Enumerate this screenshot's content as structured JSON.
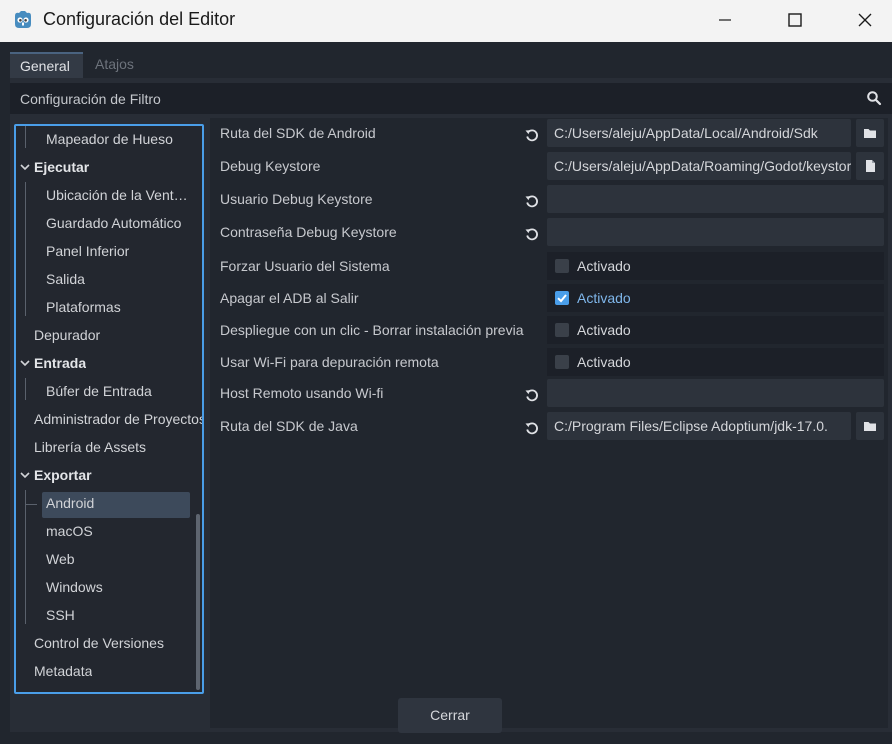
{
  "window": {
    "title": "Configuración del Editor"
  },
  "tabs": [
    {
      "label": "General"
    },
    {
      "label": "Atajos"
    }
  ],
  "filter": {
    "placeholder": "Configuración de Filtro"
  },
  "tree": [
    {
      "label": "Mapeador de Hueso",
      "kind": "leaf"
    },
    {
      "label": "Ejecutar",
      "kind": "cat"
    },
    {
      "label": "Ubicación de la Ventana",
      "kind": "leaf"
    },
    {
      "label": "Guardado Automático",
      "kind": "leaf"
    },
    {
      "label": "Panel Inferior",
      "kind": "leaf"
    },
    {
      "label": "Salida",
      "kind": "leaf"
    },
    {
      "label": "Plataformas",
      "kind": "leaf"
    },
    {
      "label": "Depurador",
      "kind": "top"
    },
    {
      "label": "Entrada",
      "kind": "cat"
    },
    {
      "label": "Búfer de Entrada",
      "kind": "leaf"
    },
    {
      "label": "Administrador de Proyectos",
      "kind": "top"
    },
    {
      "label": "Librería de Assets",
      "kind": "top"
    },
    {
      "label": "Exportar",
      "kind": "cat"
    },
    {
      "label": "Android",
      "kind": "leaf",
      "selected": true
    },
    {
      "label": "macOS",
      "kind": "leaf"
    },
    {
      "label": "Web",
      "kind": "leaf"
    },
    {
      "label": "Windows",
      "kind": "leaf"
    },
    {
      "label": "SSH",
      "kind": "leaf"
    },
    {
      "label": "Control de Versiones",
      "kind": "top"
    },
    {
      "label": "Metadata",
      "kind": "top"
    }
  ],
  "properties": [
    {
      "name": "Ruta del SDK de Android",
      "revert": true,
      "value": "C:/Users/aleju/AppData/Local/Android/Sdk",
      "browse": true
    },
    {
      "name": "Debug Keystore",
      "revert": false,
      "value": "C:/Users/aleju/AppData/Roaming/Godot/keystores/debug.keystore",
      "browse": true
    },
    {
      "name": "Usuario Debug Keystore",
      "revert": true,
      "value": ""
    },
    {
      "name": "Contraseña Debug Keystore",
      "revert": true,
      "value": ""
    },
    {
      "name": "Forzar Usuario del Sistema",
      "check": false,
      "check_label": "Activado"
    },
    {
      "name": "Apagar el ADB al Salir",
      "check": true,
      "check_label": "Activado"
    },
    {
      "name": "Despliegue con un clic - Borrar instalación previa",
      "check": false,
      "check_label": "Activado"
    },
    {
      "name": "Usar Wi-Fi para depuración remota",
      "check": false,
      "check_label": "Activado"
    },
    {
      "name": "Host Remoto usando Wi-fi",
      "revert": true,
      "value": ""
    },
    {
      "name": "Ruta del SDK de Java",
      "revert": true,
      "value": "C:/Program Files/Eclipse Adoptium/jdk-17.0.",
      "browse": true
    }
  ],
  "footer": {
    "close_label": "Cerrar"
  },
  "colors": {
    "accent": "#4a9ee9",
    "selection": "#3d4a5b",
    "panel": "#21262e"
  }
}
